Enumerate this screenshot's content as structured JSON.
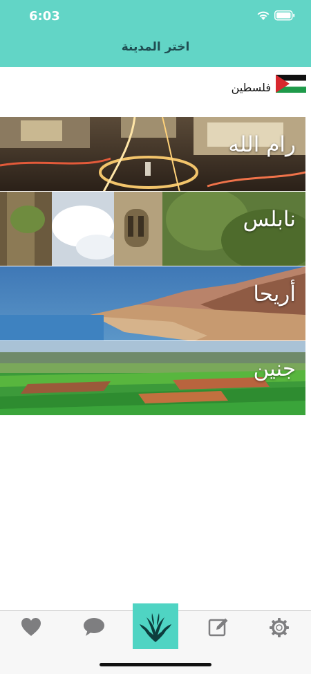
{
  "status_bar": {
    "time": "6:03"
  },
  "header": {
    "title": "اختر المدينة"
  },
  "country": {
    "name": "فلسطين",
    "flag_icon": "palestine-flag-icon"
  },
  "cities": [
    {
      "name": "رام الله"
    },
    {
      "name": "نابلس"
    },
    {
      "name": "أريحا"
    },
    {
      "name": "جنين"
    }
  ],
  "tab_bar": {
    "items": [
      "heart-icon",
      "chat-bubble-icon",
      "plant-logo-icon",
      "edit-icon",
      "gear-icon"
    ],
    "accent_color": "#4fd4c3"
  },
  "colors": {
    "header": "#62d5c6",
    "title_text": "#1f4d52"
  }
}
